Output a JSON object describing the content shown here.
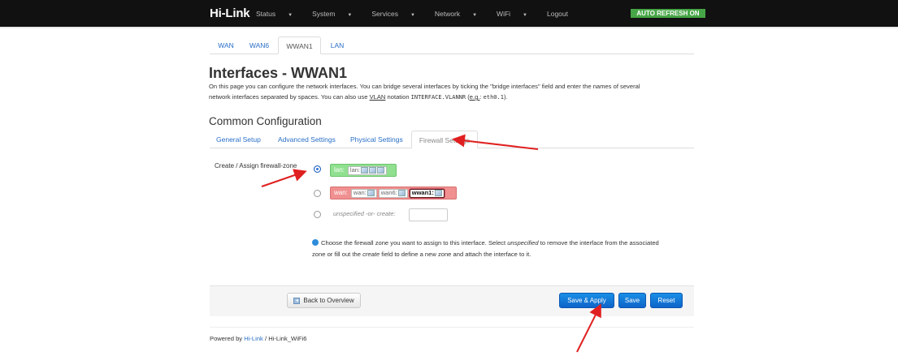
{
  "navbar": {
    "brand": "Hi-Link",
    "menu": [
      {
        "label": "Status",
        "has_caret": true
      },
      {
        "label": "System",
        "has_caret": true
      },
      {
        "label": "Services",
        "has_caret": true
      },
      {
        "label": "Network",
        "has_caret": true
      },
      {
        "label": "WiFi",
        "has_caret": true
      },
      {
        "label": "Logout",
        "has_caret": false
      }
    ],
    "auto_refresh": "AUTO REFRESH ON"
  },
  "interface_tabs": [
    "WAN",
    "WAN6",
    "WWAN1",
    "LAN"
  ],
  "active_interface_tab": "WWAN1",
  "page": {
    "title": "Interfaces - WWAN1",
    "description_1": "On this page you can configure the network interfaces. You can bridge several interfaces by ticking the \"bridge interfaces\" field and enter the names of several",
    "description_2a": "network interfaces separated by spaces. You can also use ",
    "description_vlan": "VLAN",
    "description_2b": " notation ",
    "description_code1": "INTERFACE.VLANNR",
    "description_2c": " (",
    "description_eg": "e.g.",
    "description_2d": ": ",
    "description_code2": "eth0.1",
    "description_2e": ")."
  },
  "section": {
    "title": "Common Configuration",
    "tabs": [
      "General Setup",
      "Advanced Settings",
      "Physical Settings",
      "Firewall Settings"
    ],
    "active_tab": "Firewall Settings"
  },
  "firewall_zone": {
    "label": "Create / Assign firewall-zone",
    "options": [
      {
        "zone": "lan:",
        "members": [
          "lan:"
        ],
        "selected": true,
        "color": "#90e090"
      },
      {
        "zone": "wan:",
        "members": [
          "wan:",
          "wan6:",
          "wwan1:"
        ],
        "selected": false,
        "color": "#f09090"
      },
      {
        "zone": "",
        "text": "unspecified -or- create:",
        "selected": false
      }
    ],
    "help_1": "Choose the firewall zone you want to assign to this interface. Select ",
    "help_unspecified": "unspecified",
    "help_2": " to remove the interface from the associated",
    "help_3": "zone or fill out the ",
    "help_create": "create",
    "help_4": " field to define a new zone and attach the interface to it."
  },
  "actions": {
    "back": "Back to Overview",
    "save_apply": "Save & Apply",
    "save": "Save",
    "reset": "Reset"
  },
  "footer": {
    "powered_by": "Powered by ",
    "link": "Hi-Link",
    "suffix": " / Hi-Link_WiFi6"
  },
  "colors": {
    "navbar_bg": "#111111",
    "auto_refresh_bg": "#46a546",
    "link": "#2a6fc7",
    "primary_button": "#0e64c9",
    "annotation_arrow": "#e02020"
  }
}
